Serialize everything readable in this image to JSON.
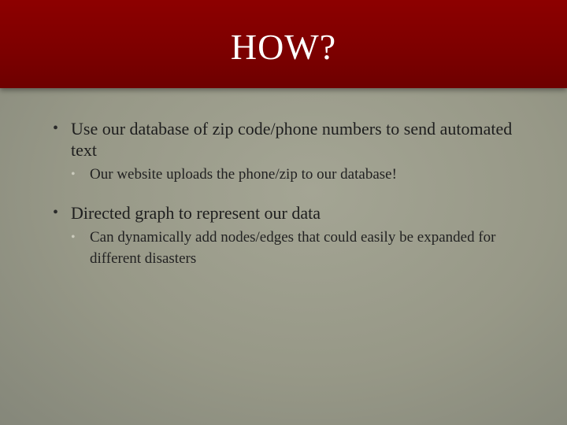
{
  "slide": {
    "title": "HOW?",
    "bullets": [
      {
        "text": "Use our database of zip code/phone numbers to send automated text",
        "sub": "Our website uploads the phone/zip to our database!"
      },
      {
        "text": "Directed graph to represent our data",
        "sub": "Can dynamically add nodes/edges that could easily be expanded for different disasters"
      }
    ],
    "bullet_marker": "•",
    "colors": {
      "title_band": "#8d0000",
      "background": "#9a9a8a",
      "title_text": "#ffffff"
    }
  }
}
